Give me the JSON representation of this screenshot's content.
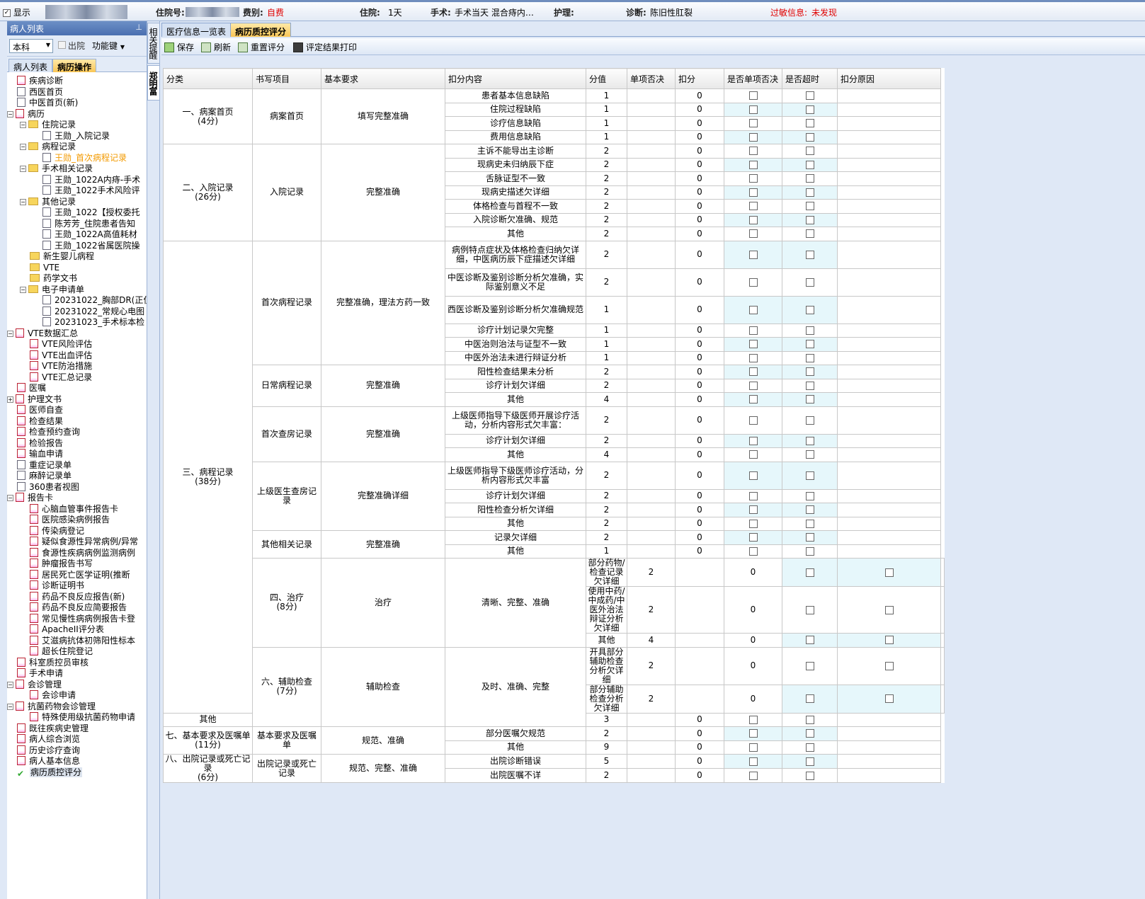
{
  "header": {
    "show_label": "显示",
    "admission_no_label": "住院号:",
    "fee_type_label": "费别:",
    "fee_type_value": "自费",
    "stay_label": "住院:",
    "stay_value": "1天",
    "surgery_label": "手术:",
    "surgery_value": "手术当天  混合痔内…",
    "nursing_label": "护理:",
    "diagnosis_label": "诊断:",
    "diagnosis_value": "陈旧性肛裂",
    "allergy_label": "过敏信息:",
    "allergy_value": "未发现"
  },
  "left_panel": {
    "title": "病人列表",
    "department": "本科",
    "discharged_label": "出院",
    "function_key_label": "功能键",
    "tabs": [
      "病人列表",
      "病历操作"
    ]
  },
  "vertical_tabs": [
    "相关提醒",
    "郑明富"
  ],
  "main_tabs": [
    "医疗信息一览表",
    "病历质控评分"
  ],
  "toolbar": {
    "save": "保存",
    "refresh": "刷新",
    "reset": "重置评分",
    "print": "评定结果打印"
  },
  "tree": [
    {
      "label": "疾病诊断",
      "icon": "doc-icon",
      "level": 0
    },
    {
      "label": "西医首页",
      "icon": "page-icon",
      "level": 0
    },
    {
      "label": "中医首页(新)",
      "icon": "page-icon",
      "level": 0
    },
    {
      "label": "病历",
      "icon": "doc-icon",
      "level": 0,
      "expander": "−"
    },
    {
      "label": "住院记录",
      "icon": "folder-icon",
      "level": 1,
      "expander": "−"
    },
    {
      "label": "王勋_入院记录",
      "icon": "page-icon",
      "level": 2
    },
    {
      "label": "病程记录",
      "icon": "folder-icon",
      "level": 1,
      "expander": "−"
    },
    {
      "label": "王勋_首次病程记录",
      "icon": "page-icon",
      "level": 2,
      "selected": true
    },
    {
      "label": "手术相关记录",
      "icon": "folder-icon",
      "level": 1,
      "expander": "−"
    },
    {
      "label": "王勋_1022A内痔-手术",
      "icon": "page-icon",
      "level": 2
    },
    {
      "label": "王勋_1022手术风险评",
      "icon": "page-icon",
      "level": 2
    },
    {
      "label": "其他记录",
      "icon": "folder-icon",
      "level": 1,
      "expander": "−"
    },
    {
      "label": "王勋_1022【授权委托",
      "icon": "page-icon",
      "level": 2
    },
    {
      "label": "陈芳芳_住院患者告知",
      "icon": "page-icon",
      "level": 2
    },
    {
      "label": "王勋_1022A高值耗材",
      "icon": "page-icon",
      "level": 2
    },
    {
      "label": "王勋_1022省属医院操",
      "icon": "page-icon",
      "level": 2
    },
    {
      "label": "新生婴儿病程",
      "icon": "folder-icon",
      "level": 1
    },
    {
      "label": "VTE",
      "icon": "folder-icon",
      "level": 1
    },
    {
      "label": "药学文书",
      "icon": "folder-icon",
      "level": 1
    },
    {
      "label": "电子申请单",
      "icon": "folder-icon",
      "level": 1,
      "expander": "−"
    },
    {
      "label": "20231022_胸部DR(正位",
      "icon": "page-icon",
      "level": 2
    },
    {
      "label": "20231022_常规心电图",
      "icon": "page-icon",
      "level": 2
    },
    {
      "label": "20231023_手术标本检",
      "icon": "page-icon",
      "level": 2
    },
    {
      "label": "VTE数据汇总",
      "icon": "doc-icon",
      "level": 0,
      "expander": "−"
    },
    {
      "label": "VTE风险评估",
      "icon": "doc-icon",
      "level": 1
    },
    {
      "label": "VTE出血评估",
      "icon": "doc-icon",
      "level": 1
    },
    {
      "label": "VTE防治措施",
      "icon": "doc-icon",
      "level": 1
    },
    {
      "label": "VTE汇总记录",
      "icon": "doc-icon",
      "level": 1
    },
    {
      "label": "医嘱",
      "icon": "doc-icon",
      "level": 0
    },
    {
      "label": "护理文书",
      "icon": "doc-icon",
      "level": 0,
      "expander": "+"
    },
    {
      "label": "医师自查",
      "icon": "doc-icon",
      "level": 0
    },
    {
      "label": "检查结果",
      "icon": "doc-icon",
      "level": 0
    },
    {
      "label": "检查预约查询",
      "icon": "doc-icon",
      "level": 0
    },
    {
      "label": "检验报告",
      "icon": "doc-icon",
      "level": 0
    },
    {
      "label": "输血申请",
      "icon": "doc-icon",
      "level": 0
    },
    {
      "label": "重症记录单",
      "icon": "page-icon",
      "level": 0
    },
    {
      "label": "麻醉记录单",
      "icon": "page-icon",
      "level": 0
    },
    {
      "label": "360患者视图",
      "icon": "page-icon",
      "level": 0
    },
    {
      "label": "报告卡",
      "icon": "doc-icon",
      "level": 0,
      "expander": "−"
    },
    {
      "label": "心脑血管事件报告卡",
      "icon": "doc-icon",
      "level": 1
    },
    {
      "label": "医院感染病例报告",
      "icon": "doc-icon",
      "level": 1
    },
    {
      "label": "传染病登记",
      "icon": "doc-icon",
      "level": 1
    },
    {
      "label": "疑似食源性异常病例/异常",
      "icon": "doc-icon",
      "level": 1
    },
    {
      "label": "食源性疾病病例监测病例",
      "icon": "doc-icon",
      "level": 1
    },
    {
      "label": "肿瘤报告书写",
      "icon": "doc-icon",
      "level": 1
    },
    {
      "label": "居民死亡医学证明(推断",
      "icon": "doc-icon",
      "level": 1
    },
    {
      "label": "诊断证明书",
      "icon": "doc-icon",
      "level": 1
    },
    {
      "label": "药品不良反应报告(新)",
      "icon": "doc-icon",
      "level": 1
    },
    {
      "label": "药品不良反应简要报告",
      "icon": "doc-icon",
      "level": 1
    },
    {
      "label": "常见慢性病病例报告卡登",
      "icon": "doc-icon",
      "level": 1
    },
    {
      "label": "ApacheII评分表",
      "icon": "doc-icon",
      "level": 1
    },
    {
      "label": "艾滋病抗体初筛阳性标本",
      "icon": "doc-icon",
      "level": 1
    },
    {
      "label": "超长住院登记",
      "icon": "doc-icon",
      "level": 1
    },
    {
      "label": "科室质控员审核",
      "icon": "doc-icon",
      "level": 0
    },
    {
      "label": "手术申请",
      "icon": "doc-icon",
      "level": 0
    },
    {
      "label": "会诊管理",
      "icon": "doc-icon",
      "level": 0,
      "expander": "−"
    },
    {
      "label": "会诊申请",
      "icon": "doc-icon",
      "level": 1
    },
    {
      "label": "抗菌药物会诊管理",
      "icon": "doc-icon",
      "level": 0,
      "expander": "−"
    },
    {
      "label": "特殊使用级抗菌药物申请",
      "icon": "doc-icon",
      "level": 1
    },
    {
      "label": "既往疾病史管理",
      "icon": "doc-icon",
      "level": 0
    },
    {
      "label": "病人综合浏览",
      "icon": "doc-icon",
      "level": 0
    },
    {
      "label": "历史诊疗查询",
      "icon": "doc-icon",
      "level": 0
    },
    {
      "label": "病人基本信息",
      "icon": "doc-icon",
      "level": 0
    },
    {
      "label": "病历质控评分",
      "icon": "check-icon",
      "level": 0,
      "current": true
    }
  ],
  "table": {
    "headers": [
      "分类",
      "书写项目",
      "基本要求",
      "扣分内容",
      "分值",
      "单项否决",
      "扣分",
      "是否单项否决",
      "是否超时",
      "扣分原因"
    ],
    "rows": [
      {
        "cat": "一、病案首页\n(4分)",
        "cat_span": 4,
        "item": "病案首页",
        "item_span": 4,
        "req": "填写完整准确",
        "req_span": 4,
        "content": "患者基本信息缺陷",
        "score": "1",
        "deduct": "0",
        "h": 1
      },
      {
        "content": "住院过程缺陷",
        "score": "1",
        "deduct": "0",
        "h": 1
      },
      {
        "content": "诊疗信息缺陷",
        "score": "1",
        "deduct": "0",
        "h": 1
      },
      {
        "content": "费用信息缺陷",
        "score": "1",
        "deduct": "0",
        "h": 1
      },
      {
        "cat": "二、入院记录\n(26分)",
        "cat_span": 7,
        "item": "入院记录",
        "item_span": 7,
        "req": "完整准确",
        "req_span": 7,
        "content": "主诉不能导出主诊断",
        "score": "2",
        "deduct": "0",
        "h": 1
      },
      {
        "content": "现病史未归纳辰下症",
        "score": "2",
        "deduct": "0",
        "h": 1
      },
      {
        "content": "舌脉证型不一致",
        "score": "2",
        "deduct": "0",
        "h": 1
      },
      {
        "content": "现病史描述欠详细",
        "score": "2",
        "deduct": "0",
        "h": 1
      },
      {
        "content": "体格检查与首程不一致",
        "score": "2",
        "deduct": "0",
        "h": 1
      },
      {
        "content": "入院诊断欠准确、规范",
        "score": "2",
        "deduct": "0",
        "h": 1
      },
      {
        "content": "其他",
        "score": "2",
        "deduct": "0",
        "h": 1
      },
      {
        "cat": "三、病程记录\n(38分)",
        "cat_span": 23,
        "item": "首次病程记录",
        "item_span": 6,
        "req": "完整准确，理法方药一致",
        "req_span": 6,
        "content": "病例特点症状及体格检查归纳欠详细，中医病历辰下症描述欠详细",
        "score": "2",
        "deduct": "0",
        "h": 2
      },
      {
        "content": "中医诊断及鉴别诊断分析欠准确，实际鉴别意义不足",
        "score": "2",
        "deduct": "0",
        "h": 2
      },
      {
        "content": "西医诊断及鉴别诊断分析欠准确规范",
        "score": "1",
        "deduct": "0",
        "h": 2
      },
      {
        "content": "诊疗计划记录欠完整",
        "score": "1",
        "deduct": "0",
        "h": 1
      },
      {
        "content": "中医治则治法与证型不一致",
        "score": "1",
        "deduct": "0",
        "h": 1
      },
      {
        "content": "中医外治法未进行辩证分析",
        "score": "1",
        "deduct": "0",
        "h": 1
      },
      {
        "item": "日常病程记录",
        "item_span": 3,
        "req": "完整准确",
        "req_span": 3,
        "content": "阳性检查结果未分析",
        "score": "2",
        "deduct": "0",
        "h": 1
      },
      {
        "content": "诊疗计划欠详细",
        "score": "2",
        "deduct": "0",
        "h": 1
      },
      {
        "content": "其他",
        "score": "4",
        "deduct": "0",
        "h": 1
      },
      {
        "item": "首次查房记录",
        "item_span": 3,
        "req": "完整准确",
        "req_span": 3,
        "content": "上级医师指导下级医师开展诊疗活动，分析内容形式欠丰富：",
        "score": "2",
        "deduct": "0",
        "h": 2
      },
      {
        "content": "诊疗计划欠详细",
        "score": "2",
        "deduct": "0",
        "h": 1
      },
      {
        "content": "其他",
        "score": "4",
        "deduct": "0",
        "h": 1
      },
      {
        "item": "上级医生查房记录",
        "item_span": 4,
        "req": "完整准确详细",
        "req_span": 4,
        "content": "上级医师指导下级医师诊疗活动，分析内容形式欠丰富",
        "score": "2",
        "deduct": "0",
        "h": 2
      },
      {
        "content": "诊疗计划欠详细",
        "score": "2",
        "deduct": "0",
        "h": 1
      },
      {
        "content": "阳性检查分析欠详细",
        "score": "2",
        "deduct": "0",
        "h": 1
      },
      {
        "content": "其他",
        "score": "2",
        "deduct": "0",
        "h": 1
      },
      {
        "item": "其他相关记录",
        "item_span": 2,
        "req": "完整准确",
        "req_span": 2,
        "content": "记录欠详细",
        "score": "2",
        "deduct": "0",
        "h": 1
      },
      {
        "content": "其他",
        "score": "1",
        "deduct": "0",
        "h": 1
      },
      {
        "cat": "四、治疗\n(8分)",
        "cat_span": 3,
        "item": "治疗",
        "item_span": 3,
        "req": "清晰、完整、准确",
        "req_span": 3,
        "content": "部分药物/检查记录欠详细",
        "score": "2",
        "deduct": "0",
        "h": 1
      },
      {
        "content": "使用中药/中成药/中医外治法辩证分析欠详细",
        "score": "2",
        "deduct": "0",
        "h": 2
      },
      {
        "content": "其他",
        "score": "4",
        "deduct": "0",
        "h": 1
      },
      {
        "cat": "六、辅助检查\n(7分)",
        "cat_span": 3,
        "item": "辅助检查",
        "item_span": 3,
        "req": "及时、准确、完整",
        "req_span": 3,
        "content": "开具部分辅助检查分析欠详细",
        "score": "2",
        "deduct": "0",
        "h": 1
      },
      {
        "content": "部分辅助检查分析欠详细",
        "score": "2",
        "deduct": "0",
        "h": 1
      },
      {
        "content": "其他",
        "score": "3",
        "deduct": "0",
        "h": 1
      },
      {
        "cat": "七、基本要求及医嘱单\n(11分)",
        "cat_span": 2,
        "item": "基本要求及医嘱单",
        "item_span": 2,
        "req": "规范、准确",
        "req_span": 2,
        "content": "部分医嘱欠规范",
        "score": "2",
        "deduct": "0",
        "h": 1
      },
      {
        "content": "其他",
        "score": "9",
        "deduct": "0",
        "h": 1
      },
      {
        "cat": "八、出院记录或死亡记录\n(6分)",
        "cat_span": 2,
        "item": "出院记录或死亡记录",
        "item_span": 2,
        "req": "规范、完整、准确",
        "req_span": 2,
        "content": "出院诊断错误",
        "score": "5",
        "deduct": "0",
        "h": 1
      },
      {
        "content": "出院医嘱不详",
        "score": "2",
        "deduct": "0",
        "h": 1
      }
    ]
  }
}
